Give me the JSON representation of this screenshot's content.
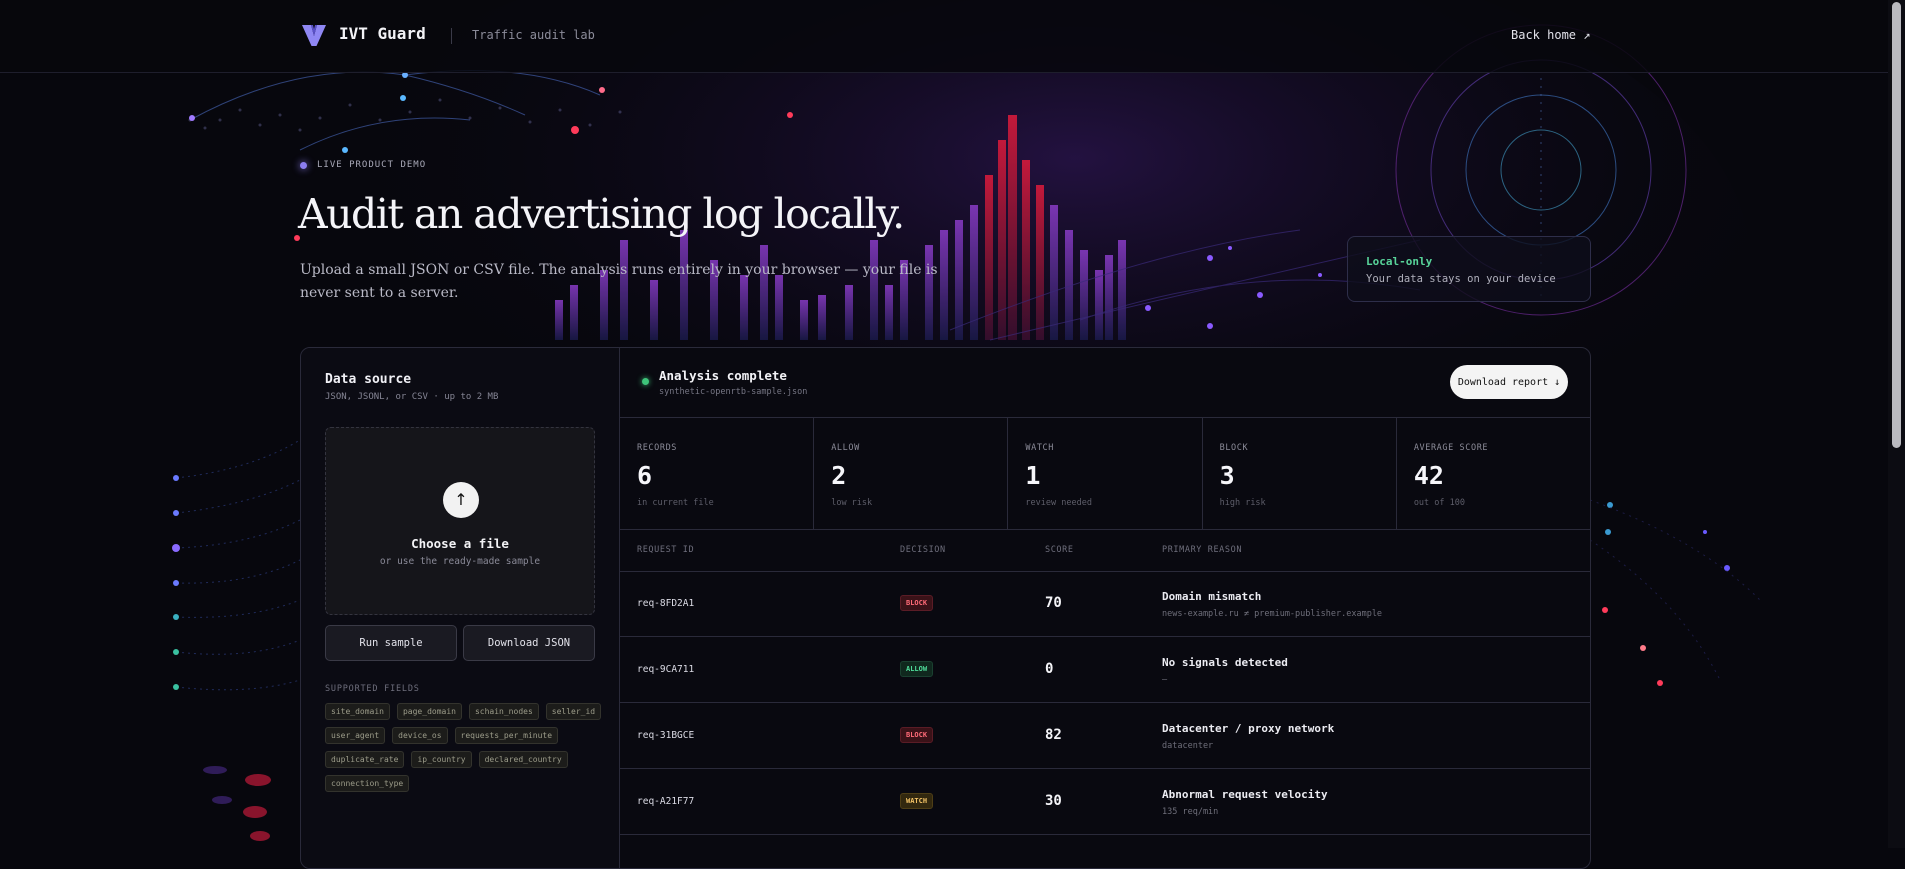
{
  "header": {
    "brand": "IVT Guard",
    "tagline": "Traffic audit lab",
    "back_home": "Back home ↗"
  },
  "hero": {
    "kicker": "LIVE PRODUCT DEMO",
    "title": "Audit an advertising log locally.",
    "subtitle": "Upload a small JSON or CSV file. The analysis runs entirely in your browser — your file is never sent to a server."
  },
  "local_card": {
    "title": "Local-only",
    "desc": "Your data stays on your device"
  },
  "data_source": {
    "title": "Data source",
    "subtitle": "JSON, JSONL, or CSV · up to 2 MB",
    "upload_glyph": "↑",
    "choose": "Choose a file",
    "or_sample": "or use the ready-made sample",
    "run_sample": "Run sample",
    "download_json": "Download JSON",
    "supported_label": "SUPPORTED FIELDS",
    "fields": [
      "site_domain",
      "page_domain",
      "schain_nodes",
      "seller_id",
      "user_agent",
      "device_os",
      "requests_per_minute",
      "duplicate_rate",
      "ip_country",
      "declared_country",
      "connection_type"
    ]
  },
  "status": {
    "title": "Analysis complete",
    "file": "synthetic-openrtb-sample.json",
    "download_report": "Download report ↓",
    "color": "#3ec47a"
  },
  "stats": [
    {
      "label": "RECORDS",
      "value": "6",
      "note": "in current file"
    },
    {
      "label": "ALLOW",
      "value": "2",
      "note": "low risk"
    },
    {
      "label": "WATCH",
      "value": "1",
      "note": "review needed"
    },
    {
      "label": "BLOCK",
      "value": "3",
      "note": "high risk"
    },
    {
      "label": "AVERAGE SCORE",
      "value": "42",
      "note": "out of 100"
    }
  ],
  "table": {
    "headers": {
      "id": "REQUEST ID",
      "decision": "DECISION",
      "score": "SCORE",
      "reason": "PRIMARY REASON"
    },
    "rows": [
      {
        "id": "req-8FD2A1",
        "decision": "BLOCK",
        "score": "70",
        "reason": "Domain mismatch",
        "detail": "news-example.ru ≠ premium-publisher.example"
      },
      {
        "id": "req-9CA711",
        "decision": "ALLOW",
        "score": "0",
        "reason": "No signals detected",
        "detail": "—"
      },
      {
        "id": "req-31BGCE",
        "decision": "BLOCK",
        "score": "82",
        "reason": "Datacenter / proxy network",
        "detail": "datacenter"
      },
      {
        "id": "req-A21F77",
        "decision": "WATCH",
        "score": "30",
        "reason": "Abnormal request velocity",
        "detail": "135 req/min"
      }
    ]
  },
  "colors": {
    "accent": "#8b7df0",
    "block": "#ff6b78",
    "allow": "#4fdc9a",
    "watch": "#f2c266",
    "background": "#07070d"
  }
}
